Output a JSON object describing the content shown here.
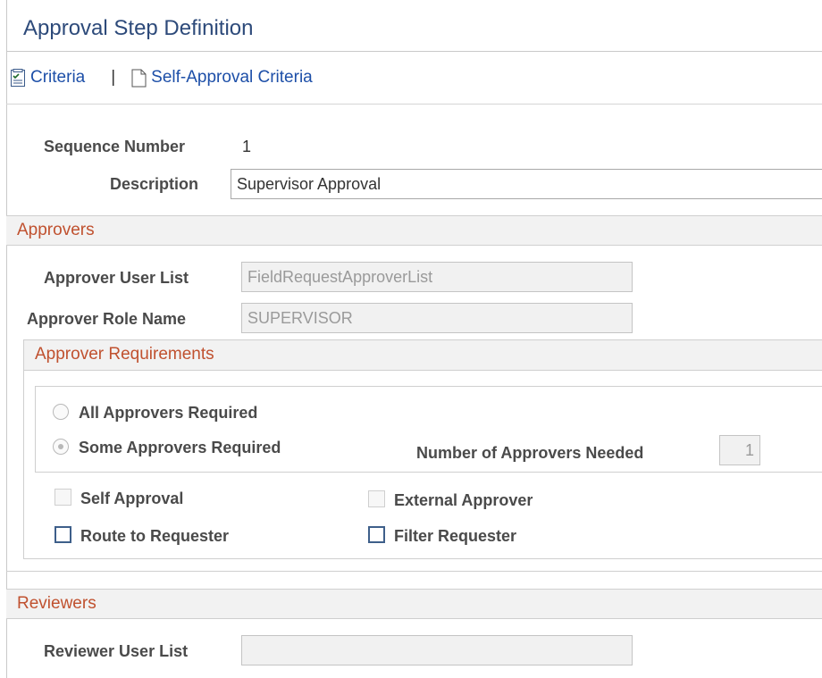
{
  "page": {
    "title": "Approval Step Definition"
  },
  "links": {
    "criteria": "Criteria",
    "separator": "|",
    "self_approval_criteria": "Self-Approval Criteria"
  },
  "fields": {
    "sequence_number_label": "Sequence Number",
    "sequence_number_value": "1",
    "description_label": "Description",
    "description_value": "Supervisor Approval"
  },
  "approvers": {
    "section_title": "Approvers",
    "user_list_label": "Approver User List",
    "user_list_value": "FieldRequestApproverList",
    "role_name_label": "Approver Role Name",
    "role_name_value": "SUPERVISOR"
  },
  "requirements": {
    "section_title": "Approver Requirements",
    "all_required_label": "All Approvers Required",
    "all_required_selected": false,
    "some_required_label": "Some Approvers Required",
    "some_required_selected": true,
    "number_needed_label": "Number of Approvers Needed",
    "number_needed_value": "1",
    "self_approval_label": "Self Approval",
    "self_approval_checked": false,
    "external_approver_label": "External Approver",
    "external_approver_checked": false,
    "route_to_requester_label": "Route to Requester",
    "route_to_requester_checked": false,
    "filter_requester_label": "Filter Requester",
    "filter_requester_checked": false
  },
  "reviewers": {
    "section_title": "Reviewers",
    "user_list_label": "Reviewer User List",
    "user_list_value": ""
  },
  "colors": {
    "title": "#2d4a7a",
    "link": "#1d4fa8",
    "section_header": "#c0512f",
    "checkbox_border": "#3e5f8a"
  },
  "icons": {
    "criteria": "criteria-checklist-icon",
    "self_approval_criteria": "document-icon"
  }
}
